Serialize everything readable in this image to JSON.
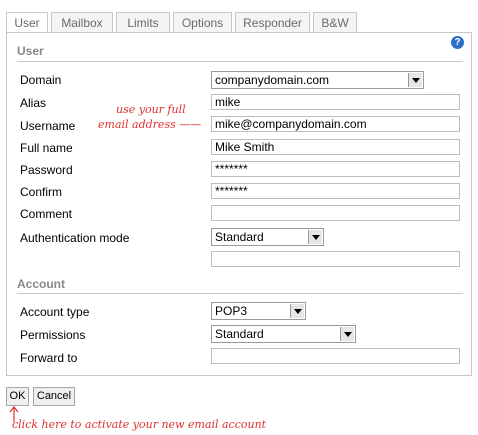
{
  "tabs": [
    "User",
    "Mailbox",
    "Limits",
    "Options",
    "Responder",
    "B&W"
  ],
  "help_icon": "help-icon",
  "sections": {
    "user": "User",
    "account": "Account"
  },
  "fields": {
    "domain": {
      "label": "Domain",
      "value": "companydomain.com"
    },
    "alias": {
      "label": "Alias",
      "value": "mike"
    },
    "username": {
      "label": "Username",
      "value": "mike@companydomain.com"
    },
    "full_name": {
      "label": "Full name",
      "value": "Mike Smith"
    },
    "password": {
      "label": "Password",
      "value": "*******"
    },
    "confirm": {
      "label": "Confirm",
      "value": "*******"
    },
    "comment": {
      "label": "Comment",
      "value": ""
    },
    "auth_mode": {
      "label": "Authentication mode",
      "value": "Standard"
    },
    "auth_extra": {
      "value": ""
    },
    "account_type": {
      "label": "Account type",
      "value": "POP3"
    },
    "permissions": {
      "label": "Permissions",
      "value": "Standard"
    },
    "forward_to": {
      "label": "Forward to",
      "value": ""
    }
  },
  "buttons": {
    "ok": "OK",
    "cancel": "Cancel"
  },
  "annotations": {
    "username_line1": "use your full",
    "username_line2": "email address ——",
    "ok_hint": "click here to activate your new email account"
  },
  "colors": {
    "annotation": "#e03030",
    "help": "#2a70c8",
    "section": "#888888"
  }
}
